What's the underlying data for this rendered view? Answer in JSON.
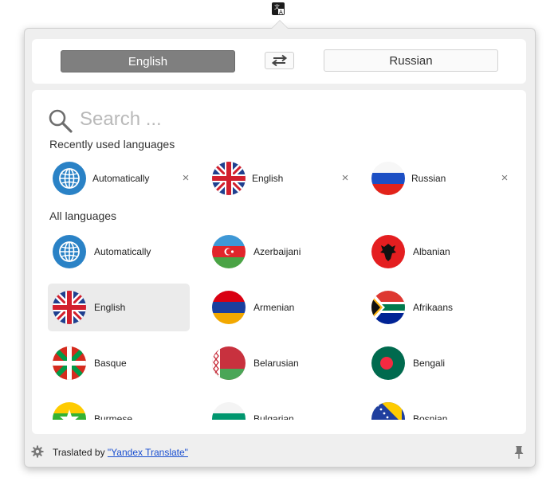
{
  "menubar": {
    "icon": "translate-icon"
  },
  "header": {
    "source_language": "English",
    "target_language": "Russian",
    "swap_icon": "swap-arrows-icon"
  },
  "search": {
    "placeholder": "Search ...",
    "value": "",
    "icon": "search-icon"
  },
  "recent": {
    "title": "Recently used languages",
    "items": [
      {
        "label": "Automatically",
        "flag": "globe",
        "remove": "×"
      },
      {
        "label": "English",
        "flag": "uk",
        "remove": "×"
      },
      {
        "label": "Russian",
        "flag": "russia",
        "remove": "×"
      }
    ]
  },
  "all": {
    "title": "All languages",
    "items": [
      {
        "label": "Automatically",
        "flag": "globe"
      },
      {
        "label": "Azerbaijani",
        "flag": "azerbaijan"
      },
      {
        "label": "Albanian",
        "flag": "albania"
      },
      {
        "label": "English",
        "flag": "uk",
        "selected": true
      },
      {
        "label": "Armenian",
        "flag": "armenia"
      },
      {
        "label": "Afrikaans",
        "flag": "south-africa"
      },
      {
        "label": "Basque",
        "flag": "basque"
      },
      {
        "label": "Belarusian",
        "flag": "belarus"
      },
      {
        "label": "Bengali",
        "flag": "bangladesh"
      },
      {
        "label": "Burmese",
        "flag": "myanmar"
      },
      {
        "label": "Bulgarian",
        "flag": "bulgaria"
      },
      {
        "label": "Bosnian",
        "flag": "bosnia"
      }
    ]
  },
  "footer": {
    "prefix": "Traslated by ",
    "link": "\"Yandex Translate\"",
    "gear_icon": "gear-icon",
    "pin_icon": "pin-icon"
  },
  "colors": {
    "selected_bg": "#ebebeb",
    "source_button": "#7f7f7f",
    "link": "#1a4fd0",
    "globe": "#2a82c6"
  }
}
